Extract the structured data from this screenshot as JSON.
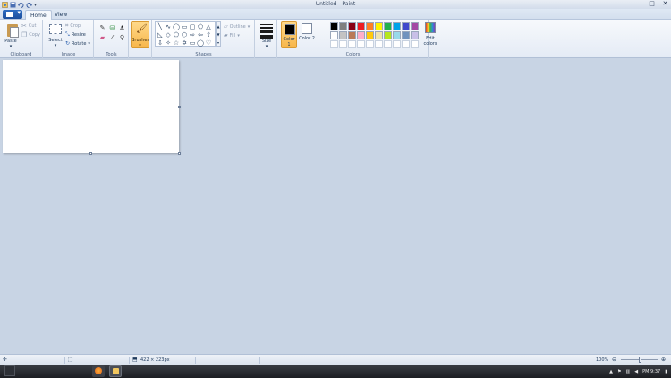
{
  "window": {
    "title": "Untitled - Paint",
    "controls": {
      "minimize": "–",
      "maximize": "□",
      "close": "✕"
    }
  },
  "tabs": {
    "app_menu_icon": "paint-document-icon",
    "home": "Home",
    "view": "View"
  },
  "clipboard": {
    "paste": "Paste",
    "cut": "Cut",
    "copy": "Copy",
    "label": "Clipboard"
  },
  "image": {
    "select": "Select",
    "crop": "Crop",
    "resize": "Resize",
    "rotate": "Rotate",
    "label": "Image"
  },
  "tools": {
    "label": "Tools",
    "text_glyph": "A"
  },
  "brushes": {
    "label": "Brushes"
  },
  "shapes": {
    "outline": "Outline",
    "fill": "Fill",
    "label": "Shapes"
  },
  "size": {
    "label": "Size"
  },
  "colors": {
    "color1": "Color 1",
    "color2": "Color 2",
    "color1_value": "#000000",
    "color2_value": "#ffffff",
    "edit": "Edit colors",
    "label": "Colors",
    "palette": [
      "#000000",
      "#7f7f7f",
      "#880015",
      "#ed1c24",
      "#ff7f27",
      "#fff200",
      "#22b14c",
      "#00a2e8",
      "#3f48cc",
      "#a349a4",
      "#ffffff",
      "#c3c3c3",
      "#b97a57",
      "#ffaec9",
      "#ffc90e",
      "#efe4b0",
      "#b5e61d",
      "#99d9ea",
      "#7092be",
      "#c8bfe7",
      "#ffffff",
      "#ffffff",
      "#ffffff",
      "#ffffff",
      "#ffffff",
      "#ffffff",
      "#ffffff",
      "#ffffff",
      "#ffffff",
      "#ffffff"
    ]
  },
  "status": {
    "dimensions": "422 × 223px",
    "zoom": "100%"
  },
  "taskbar": {
    "time": "PM 9:37"
  }
}
